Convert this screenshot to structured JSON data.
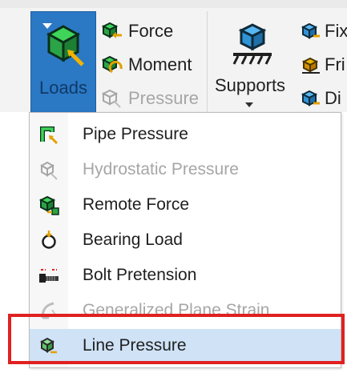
{
  "ribbon": {
    "loads": {
      "label": "Loads"
    },
    "commands": [
      {
        "id": "force",
        "label": "Force",
        "enabled": true,
        "icon": "force-icon"
      },
      {
        "id": "moment",
        "label": "Moment",
        "enabled": true,
        "icon": "moment-icon"
      },
      {
        "id": "pressure",
        "label": "Pressure",
        "enabled": false,
        "icon": "pressure-icon"
      }
    ],
    "supports": {
      "label": "Supports"
    },
    "right_partial": [
      {
        "label": "Fix",
        "icon": "fixed-support-icon"
      },
      {
        "label": "Fri",
        "icon": "frictionless-support-icon"
      },
      {
        "label": "Di",
        "icon": "displacement-icon"
      }
    ]
  },
  "loads_menu": {
    "items": [
      {
        "label": "Pipe Pressure",
        "enabled": true,
        "icon": "pipe-pressure-icon"
      },
      {
        "label": "Hydrostatic Pressure",
        "enabled": false,
        "icon": "hydrostatic-pressure-icon"
      },
      {
        "label": "Remote Force",
        "enabled": true,
        "icon": "remote-force-icon"
      },
      {
        "label": "Bearing Load",
        "enabled": true,
        "icon": "bearing-load-icon"
      },
      {
        "label": "Bolt Pretension",
        "enabled": true,
        "icon": "bolt-pretension-icon"
      },
      {
        "label": "Generalized Plane Strain",
        "enabled": false,
        "icon": "generalized-plane-strain-icon"
      },
      {
        "label": "Line Pressure",
        "enabled": true,
        "highlighted": true,
        "icon": "line-pressure-icon"
      }
    ]
  },
  "colors": {
    "accent": "#2b78c5",
    "highlight": "#cfe2f6",
    "annotation": "#e02020",
    "disabled_text": "#a6a6a6"
  }
}
